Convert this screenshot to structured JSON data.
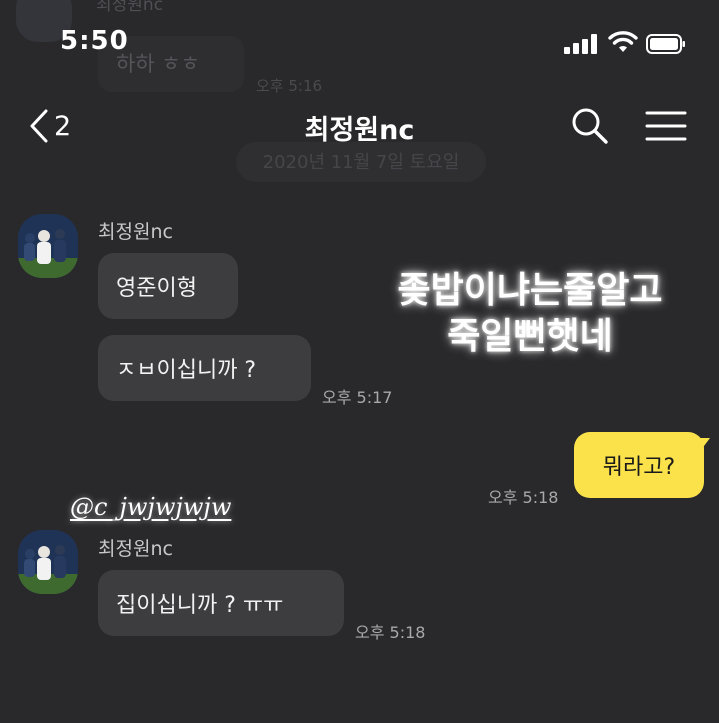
{
  "background_previous": {
    "name": "최정원nc",
    "bubble_text": "하하 ㅎㅎ",
    "time": "오후 5:16",
    "date_label": "2020년 11월 7일 토요일"
  },
  "status_bar": {
    "time": "5:50"
  },
  "nav": {
    "back_count": "2",
    "title": "최정원nc"
  },
  "messages": {
    "group1": {
      "sender": "최정원nc",
      "bubble1": "영준이형",
      "bubble2": "ㅈㅂ이십니까 ?",
      "time": "오후 5:17"
    },
    "outgoing": {
      "text": "뭐라고?",
      "time": "오후 5:18"
    },
    "group2": {
      "sender": "최정원nc",
      "bubble1": "집이십니까 ? ㅠㅠ",
      "time": "오후 5:18"
    }
  },
  "overlay": {
    "line1": "좆밥이냐는줄알고",
    "line2": "죽일뻔햇네"
  },
  "watermark": "@c_jwjwjwjw",
  "colors": {
    "background": "#29292b",
    "incoming_bubble": "#3d3d40",
    "outgoing_bubble": "#fbe24b"
  }
}
